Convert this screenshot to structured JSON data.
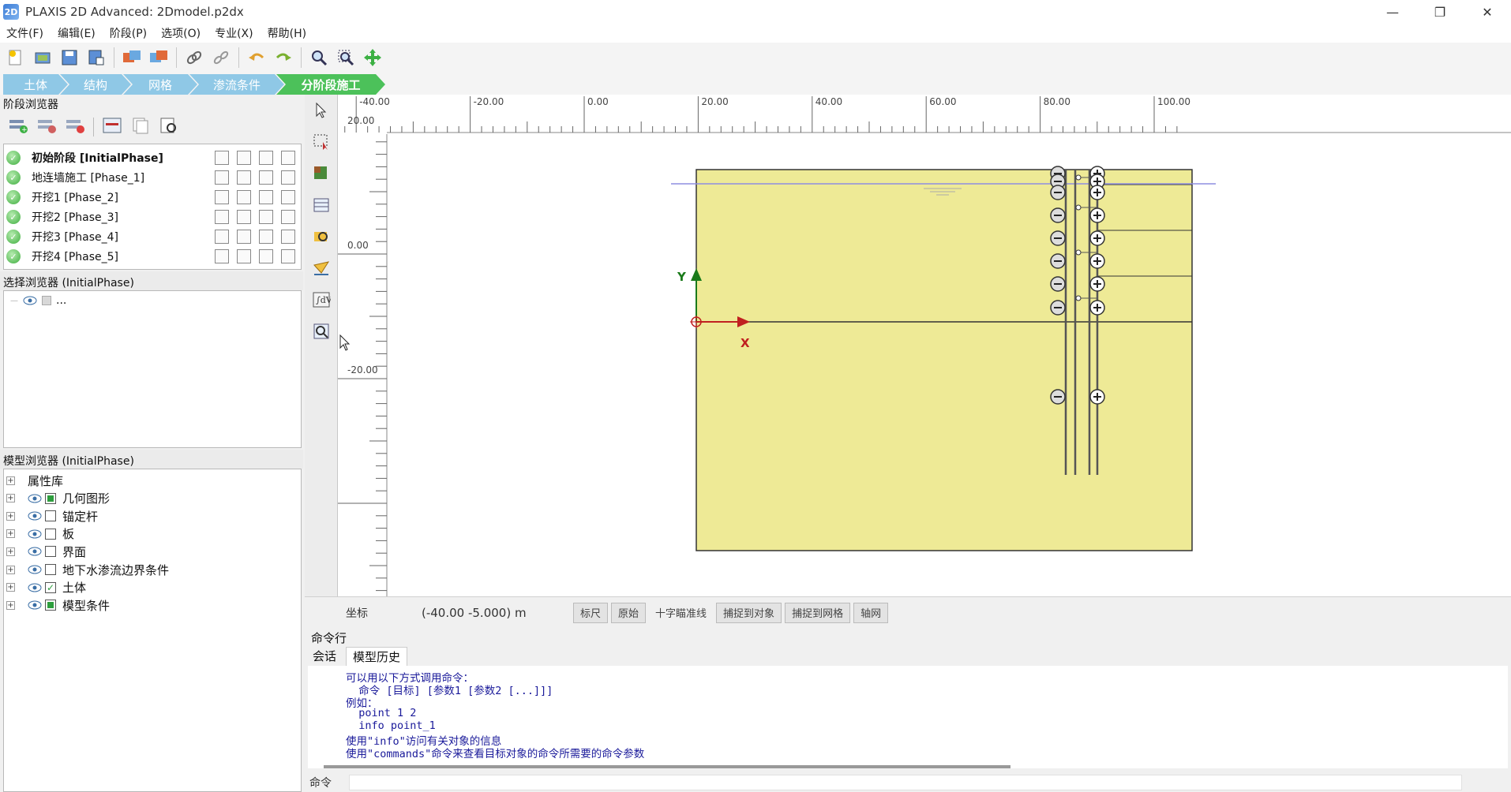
{
  "window": {
    "title": "PLAXIS 2D Advanced: 2Dmodel.p2dx",
    "minimize": "—",
    "restore": "❐",
    "close": "✕"
  },
  "menu": [
    "文件(F)",
    "编辑(E)",
    "阶段(P)",
    "选项(O)",
    "专业(X)",
    "帮助(H)"
  ],
  "toolbar_icons": [
    "new-file-icon",
    "open-file-icon",
    "save-icon",
    "save-as-icon",
    "import-icon",
    "export-icon",
    "link-icon",
    "unlink-icon",
    "undo-icon",
    "redo-icon",
    "zoom-icon",
    "zoom-window-icon",
    "move-icon"
  ],
  "mode_tabs": [
    {
      "label": "土体",
      "active": false
    },
    {
      "label": "结构",
      "active": false
    },
    {
      "label": "网格",
      "active": false
    },
    {
      "label": "渗流条件",
      "active": false
    },
    {
      "label": "分阶段施工",
      "active": true
    }
  ],
  "phases_explorer": {
    "title": "阶段浏览器",
    "phases": [
      {
        "label": "初始阶段 [InitialPhase]",
        "bold": true
      },
      {
        "label": "地连墙施工 [Phase_1]",
        "bold": false
      },
      {
        "label": "开挖1 [Phase_2]",
        "bold": false
      },
      {
        "label": "开挖2 [Phase_3]",
        "bold": false
      },
      {
        "label": "开挖3 [Phase_4]",
        "bold": false
      },
      {
        "label": "开挖4 [Phase_5]",
        "bold": false
      }
    ]
  },
  "selection_explorer": {
    "title": "选择浏览器 (InitialPhase)",
    "item": "..."
  },
  "model_explorer": {
    "title": "模型浏览器 (InitialPhase)",
    "items": [
      {
        "label": "属性库",
        "has_eye": false,
        "cb": "none"
      },
      {
        "label": "几何图形",
        "has_eye": true,
        "cb": "filled"
      },
      {
        "label": "锚定杆",
        "has_eye": true,
        "cb": "empty"
      },
      {
        "label": "板",
        "has_eye": true,
        "cb": "empty"
      },
      {
        "label": "界面",
        "has_eye": true,
        "cb": "empty"
      },
      {
        "label": "地下水渗流边界条件",
        "has_eye": true,
        "cb": "empty"
      },
      {
        "label": "土体",
        "has_eye": true,
        "cb": "checked"
      },
      {
        "label": "模型条件",
        "has_eye": true,
        "cb": "filled"
      }
    ]
  },
  "side_tools": [
    "select-arrow-icon",
    "select-rectangle-icon",
    "soil-icon",
    "table-icon",
    "zoom-in-icon",
    "water-level-icon",
    "formula-icon",
    "zoom-extent-icon"
  ],
  "ruler": {
    "x_labels": [
      "-40.00",
      "-20.00",
      "0.00",
      "20.00",
      "40.00",
      "60.00",
      "80.00",
      "100.00"
    ],
    "y_labels": [
      "20.00",
      "0.00",
      "-20.00"
    ]
  },
  "axes": {
    "y": "Y",
    "x": "X"
  },
  "status": {
    "coord_label": "坐标",
    "coord_value": "(-40.00 -5.000) m",
    "buttons": [
      {
        "label": "标尺",
        "flat": false
      },
      {
        "label": "原始",
        "flat": false
      },
      {
        "label": "十字瞄准线",
        "flat": true
      },
      {
        "label": "捕捉到对象",
        "flat": false
      },
      {
        "label": "捕捉到网格",
        "flat": false
      },
      {
        "label": "轴网",
        "flat": false
      }
    ]
  },
  "command": {
    "title": "命令行",
    "tabs": [
      "会话",
      "模型历史"
    ],
    "lines": [
      "可以用以下方式调用命令：",
      "  命令 [目标] [参数1 [参数2 [...]]]",
      "例如：",
      "  point 1 2",
      "  info point_1",
      "使用\"info\"访问有关对象的信息",
      "使用\"commands\"命令来查看目标对象的命令所需要的命令参数"
    ],
    "input_label": "命令"
  },
  "colors": {
    "soil": "#eeea96",
    "active_tab": "#4cc15a",
    "inactive_tab": "#8fc8e6",
    "command_text": "#1a1a9a"
  }
}
